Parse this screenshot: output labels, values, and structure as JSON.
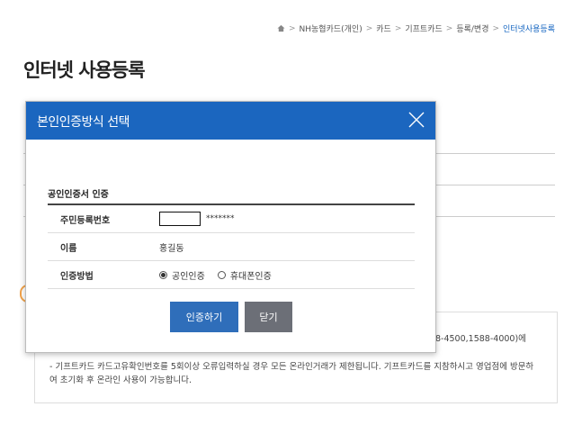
{
  "breadcrumb": {
    "items": [
      "NH농협카드(개인)",
      "카드",
      "기프트카드",
      "등록/변경"
    ],
    "separator": ">",
    "current": "인터넷사용등록"
  },
  "page": {
    "title": "인터넷 사용등록"
  },
  "notice": {
    "line_tail": "8-4500,1588-4000)에",
    "text": "- 기프트카드 카드고유확인번호를 5회이상 오류입력하실 경우 모든 온라인거래가 제한됩니다. 기프트카드를 지참하시고 영업점에 방문하여 초기화 후 온라인 사용이 가능합니다."
  },
  "modal": {
    "title": "본인인증방식 선택",
    "section_title": "공인인증서 인증",
    "rows": {
      "rrn": {
        "label": "주민등록번호",
        "masked": "*******"
      },
      "name": {
        "label": "이름",
        "value": "홍길동"
      },
      "method": {
        "label": "인증방법",
        "options": [
          {
            "label": "공인인증",
            "selected": true
          },
          {
            "label": "휴대폰인증",
            "selected": false
          }
        ]
      }
    },
    "buttons": {
      "confirm": "인증하기",
      "close": "닫기"
    }
  },
  "colors": {
    "header": "#1b66bf",
    "primary_button": "#2f6eba",
    "secondary_button": "#6c6f77",
    "breadcrumb_current": "#1565c0"
  }
}
